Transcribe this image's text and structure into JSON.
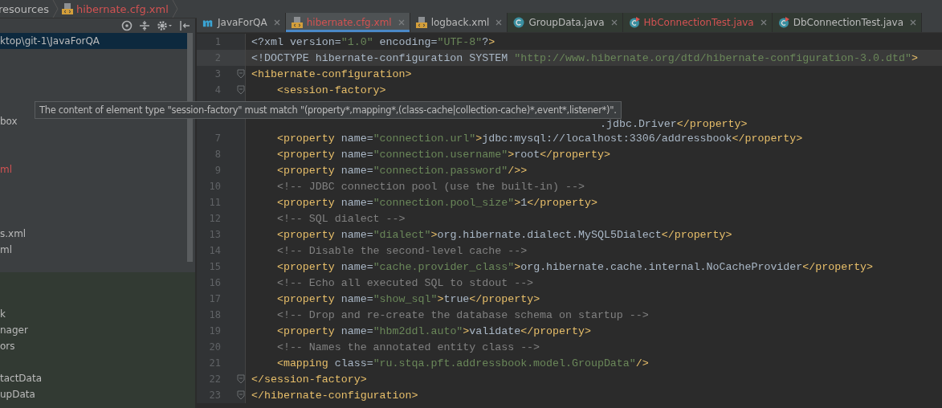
{
  "breadcrumb": [
    {
      "text": "resources",
      "kind": "folder"
    },
    {
      "text": "hibernate.cfg.xml",
      "kind": "file"
    }
  ],
  "project_tree": {
    "items": [
      {
        "kind": "item",
        "text": "ktop\\git-1\\JavaForQA",
        "selected": true,
        "error": false
      },
      {
        "kind": "cut"
      },
      {
        "kind": "cut"
      },
      {
        "kind": "cut"
      },
      {
        "kind": "cut"
      },
      {
        "kind": "item",
        "text": "box",
        "selected": false,
        "error": false
      },
      {
        "kind": "cut"
      },
      {
        "kind": "cut"
      },
      {
        "kind": "item",
        "text": "ml",
        "selected": false,
        "error": true
      },
      {
        "kind": "cut"
      },
      {
        "kind": "cut"
      },
      {
        "kind": "cut"
      },
      {
        "kind": "item",
        "text": "s.xml",
        "selected": false,
        "error": false
      },
      {
        "kind": "item",
        "text": "ml",
        "selected": false,
        "error": false
      }
    ]
  },
  "structure_tree": {
    "items": [
      {
        "kind": "cut"
      },
      {
        "kind": "cut"
      },
      {
        "kind": "item",
        "text": "k",
        "selected": false,
        "error": false
      },
      {
        "kind": "item",
        "text": "nager",
        "selected": false,
        "error": false
      },
      {
        "kind": "item",
        "text": "ors",
        "selected": false,
        "error": false
      },
      {
        "kind": "cut"
      },
      {
        "kind": "item",
        "text": "tactData",
        "selected": false,
        "error": false
      },
      {
        "kind": "item",
        "text": "upData",
        "selected": false,
        "error": false
      }
    ]
  },
  "tabs": [
    {
      "label": "JavaForQA",
      "kind": "maven",
      "selected": false,
      "error": false
    },
    {
      "label": "hibernate.cfg.xml",
      "kind": "xml",
      "selected": true,
      "error": true
    },
    {
      "label": "logback.xml",
      "kind": "xml",
      "selected": false,
      "error": false
    },
    {
      "label": "GroupData.java",
      "kind": "class",
      "selected": false,
      "error": false
    },
    {
      "label": "HbConnectionTest.java",
      "kind": "test",
      "selected": false,
      "error": true
    },
    {
      "label": "DbConnectionTest.java",
      "kind": "test",
      "selected": false,
      "error": false
    }
  ],
  "editor": {
    "lines": [
      {
        "number": "1",
        "code": "<?xml version=\"1.0\" encoding=\"UTF-8\"?>",
        "current": false,
        "fold": false
      },
      {
        "number": "2",
        "code": "<!DOCTYPE hibernate-configuration SYSTEM \"http://www.hibernate.org/dtd/hibernate-configuration-3.0.dtd\">",
        "current": true,
        "fold": false
      },
      {
        "number": "3",
        "code": "<hibernate-configuration>",
        "current": false,
        "fold": true
      },
      {
        "number": "4",
        "code": "    <session-factory>",
        "current": false,
        "fold": true
      },
      {
        "covered": true,
        "tail": ".jdbc.Driver</property>"
      },
      {
        "number": "7",
        "code": "    <property name=\"connection.url\">jdbc:mysql://localhost:3306/addressbook</property>",
        "current": false,
        "fold": false
      },
      {
        "number": "8",
        "code": "    <property name=\"connection.username\">root</property>",
        "current": false,
        "fold": false
      },
      {
        "number": "9",
        "code": "    <property name=\"connection.password\"/>>",
        "current": false,
        "fold": false
      },
      {
        "number": "10",
        "code": "    <!-- JDBC connection pool (use the built-in) -->",
        "current": false,
        "fold": false
      },
      {
        "number": "11",
        "code": "    <property name=\"connection.pool_size\">1</property>",
        "current": false,
        "fold": false
      },
      {
        "number": "12",
        "code": "    <!-- SQL dialect -->",
        "current": false,
        "fold": false
      },
      {
        "number": "13",
        "code": "    <property name=\"dialect\">org.hibernate.dialect.MySQL5Dialect</property>",
        "current": false,
        "fold": false
      },
      {
        "number": "14",
        "code": "    <!-- Disable the second-level cache -->",
        "current": false,
        "fold": false
      },
      {
        "number": "15",
        "code": "    <property name=\"cache.provider_class\">org.hibernate.cache.internal.NoCacheProvider</property>",
        "current": false,
        "fold": false
      },
      {
        "number": "16",
        "code": "    <!-- Echo all executed SQL to stdout -->",
        "current": false,
        "fold": false
      },
      {
        "number": "17",
        "code": "    <property name=\"show_sql\">true</property>",
        "current": false,
        "fold": false
      },
      {
        "number": "18",
        "code": "    <!-- Drop and re-create the database schema on startup -->",
        "current": false,
        "fold": false
      },
      {
        "number": "19",
        "code": "    <property name=\"hbm2ddl.auto\">validate</property>",
        "current": false,
        "fold": false
      },
      {
        "number": "20",
        "code": "    <!-- Names the annotated entity class -->",
        "current": false,
        "fold": false
      },
      {
        "number": "21",
        "code": "    <mapping class=\"ru.stqa.pft.addressbook.model.GroupData\"/>",
        "current": false,
        "fold": false
      },
      {
        "number": "22",
        "code": "</session-factory>",
        "current": false,
        "fold": true
      },
      {
        "number": "23",
        "code": "</hibernate-configuration>",
        "current": false,
        "fold": true
      }
    ]
  },
  "tooltip": {
    "text": "The content of element type \"session-factory\" must match \"(property*,mapping*,(class-cache|collection-cache)*,event*,listener*)\"."
  }
}
